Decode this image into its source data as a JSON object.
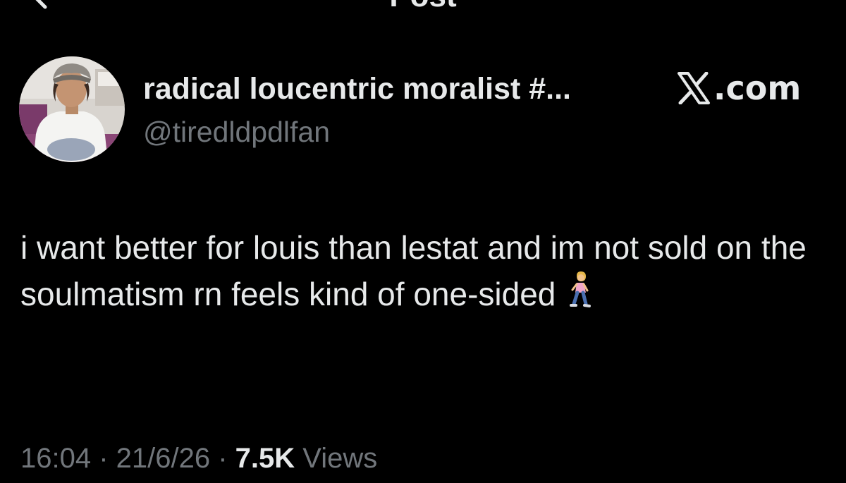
{
  "header": {
    "title": "Post",
    "back_icon": "chevron-left-icon"
  },
  "author": {
    "display_name": "radical loucentric moralist #...",
    "handle": "@tiredldpdlfan",
    "avatar": "profile-photo"
  },
  "watermark": {
    "label": ".com",
    "icon": "x-logo-icon"
  },
  "post": {
    "text": "i want better for louis than lestat and im not sold on the soulmatism rn feels kind of one-sided",
    "emoji": "woman-walking-emoji"
  },
  "meta": {
    "time": "16:04",
    "separator_1": " · ",
    "date": "21/6/26",
    "separator_2": " · ",
    "views_count": "7.5K",
    "views_label": " Views"
  },
  "colors": {
    "background": "#000000",
    "primary_text": "#e7e9ea",
    "secondary_text": "#71767b"
  }
}
